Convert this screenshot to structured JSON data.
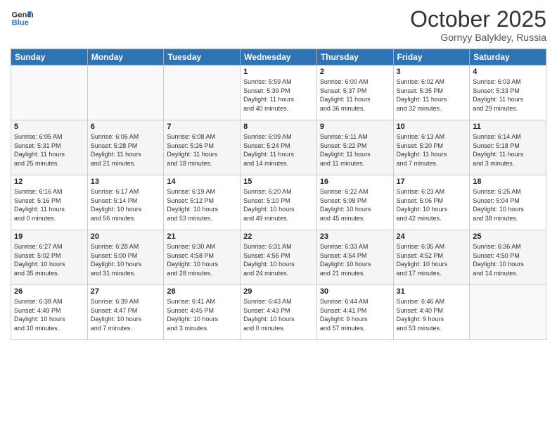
{
  "header": {
    "logo_line1": "General",
    "logo_line2": "Blue",
    "month": "October 2025",
    "location": "Gornyy Balykley, Russia"
  },
  "days_of_week": [
    "Sunday",
    "Monday",
    "Tuesday",
    "Wednesday",
    "Thursday",
    "Friday",
    "Saturday"
  ],
  "weeks": [
    [
      {
        "day": "",
        "info": ""
      },
      {
        "day": "",
        "info": ""
      },
      {
        "day": "",
        "info": ""
      },
      {
        "day": "1",
        "info": "Sunrise: 5:59 AM\nSunset: 5:39 PM\nDaylight: 11 hours\nand 40 minutes."
      },
      {
        "day": "2",
        "info": "Sunrise: 6:00 AM\nSunset: 5:37 PM\nDaylight: 11 hours\nand 36 minutes."
      },
      {
        "day": "3",
        "info": "Sunrise: 6:02 AM\nSunset: 5:35 PM\nDaylight: 11 hours\nand 32 minutes."
      },
      {
        "day": "4",
        "info": "Sunrise: 6:03 AM\nSunset: 5:33 PM\nDaylight: 11 hours\nand 29 minutes."
      }
    ],
    [
      {
        "day": "5",
        "info": "Sunrise: 6:05 AM\nSunset: 5:31 PM\nDaylight: 11 hours\nand 25 minutes."
      },
      {
        "day": "6",
        "info": "Sunrise: 6:06 AM\nSunset: 5:28 PM\nDaylight: 11 hours\nand 21 minutes."
      },
      {
        "day": "7",
        "info": "Sunrise: 6:08 AM\nSunset: 5:26 PM\nDaylight: 11 hours\nand 18 minutes."
      },
      {
        "day": "8",
        "info": "Sunrise: 6:09 AM\nSunset: 5:24 PM\nDaylight: 11 hours\nand 14 minutes."
      },
      {
        "day": "9",
        "info": "Sunrise: 6:11 AM\nSunset: 5:22 PM\nDaylight: 11 hours\nand 11 minutes."
      },
      {
        "day": "10",
        "info": "Sunrise: 6:13 AM\nSunset: 5:20 PM\nDaylight: 11 hours\nand 7 minutes."
      },
      {
        "day": "11",
        "info": "Sunrise: 6:14 AM\nSunset: 5:18 PM\nDaylight: 11 hours\nand 3 minutes."
      }
    ],
    [
      {
        "day": "12",
        "info": "Sunrise: 6:16 AM\nSunset: 5:16 PM\nDaylight: 11 hours\nand 0 minutes."
      },
      {
        "day": "13",
        "info": "Sunrise: 6:17 AM\nSunset: 5:14 PM\nDaylight: 10 hours\nand 56 minutes."
      },
      {
        "day": "14",
        "info": "Sunrise: 6:19 AM\nSunset: 5:12 PM\nDaylight: 10 hours\nand 53 minutes."
      },
      {
        "day": "15",
        "info": "Sunrise: 6:20 AM\nSunset: 5:10 PM\nDaylight: 10 hours\nand 49 minutes."
      },
      {
        "day": "16",
        "info": "Sunrise: 6:22 AM\nSunset: 5:08 PM\nDaylight: 10 hours\nand 45 minutes."
      },
      {
        "day": "17",
        "info": "Sunrise: 6:23 AM\nSunset: 5:06 PM\nDaylight: 10 hours\nand 42 minutes."
      },
      {
        "day": "18",
        "info": "Sunrise: 6:25 AM\nSunset: 5:04 PM\nDaylight: 10 hours\nand 38 minutes."
      }
    ],
    [
      {
        "day": "19",
        "info": "Sunrise: 6:27 AM\nSunset: 5:02 PM\nDaylight: 10 hours\nand 35 minutes."
      },
      {
        "day": "20",
        "info": "Sunrise: 6:28 AM\nSunset: 5:00 PM\nDaylight: 10 hours\nand 31 minutes."
      },
      {
        "day": "21",
        "info": "Sunrise: 6:30 AM\nSunset: 4:58 PM\nDaylight: 10 hours\nand 28 minutes."
      },
      {
        "day": "22",
        "info": "Sunrise: 6:31 AM\nSunset: 4:56 PM\nDaylight: 10 hours\nand 24 minutes."
      },
      {
        "day": "23",
        "info": "Sunrise: 6:33 AM\nSunset: 4:54 PM\nDaylight: 10 hours\nand 21 minutes."
      },
      {
        "day": "24",
        "info": "Sunrise: 6:35 AM\nSunset: 4:52 PM\nDaylight: 10 hours\nand 17 minutes."
      },
      {
        "day": "25",
        "info": "Sunrise: 6:36 AM\nSunset: 4:50 PM\nDaylight: 10 hours\nand 14 minutes."
      }
    ],
    [
      {
        "day": "26",
        "info": "Sunrise: 6:38 AM\nSunset: 4:49 PM\nDaylight: 10 hours\nand 10 minutes."
      },
      {
        "day": "27",
        "info": "Sunrise: 6:39 AM\nSunset: 4:47 PM\nDaylight: 10 hours\nand 7 minutes."
      },
      {
        "day": "28",
        "info": "Sunrise: 6:41 AM\nSunset: 4:45 PM\nDaylight: 10 hours\nand 3 minutes."
      },
      {
        "day": "29",
        "info": "Sunrise: 6:43 AM\nSunset: 4:43 PM\nDaylight: 10 hours\nand 0 minutes."
      },
      {
        "day": "30",
        "info": "Sunrise: 6:44 AM\nSunset: 4:41 PM\nDaylight: 9 hours\nand 57 minutes."
      },
      {
        "day": "31",
        "info": "Sunrise: 6:46 AM\nSunset: 4:40 PM\nDaylight: 9 hours\nand 53 minutes."
      },
      {
        "day": "",
        "info": ""
      }
    ]
  ]
}
